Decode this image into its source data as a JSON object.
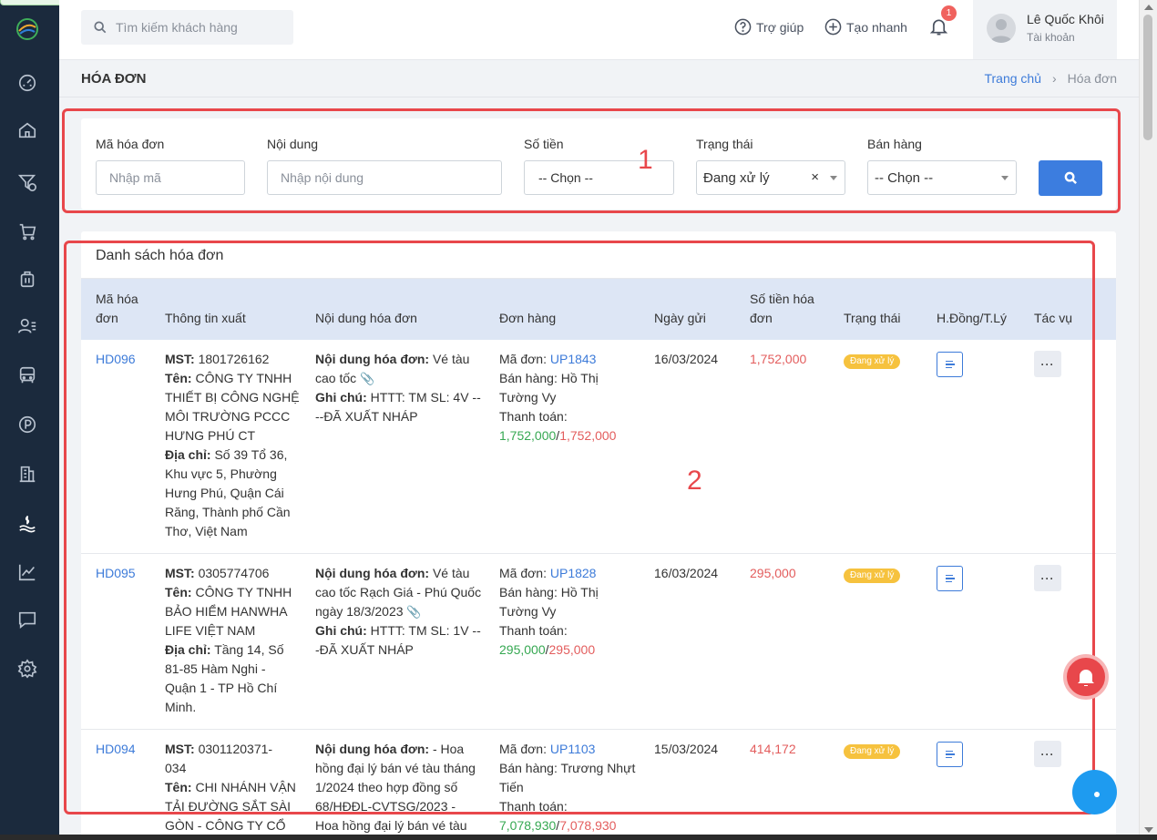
{
  "topbar": {
    "search_placeholder": "Tìm kiếm khách hàng",
    "help_label": "Trợ giúp",
    "quick_create_label": "Tạo nhanh",
    "notification_count": "1",
    "user_name": "Lê Quốc Khôi",
    "user_role": "Tài khoản"
  },
  "page": {
    "title": "HÓA ĐƠN",
    "breadcrumb_home": "Trang chủ",
    "breadcrumb_sep": "›",
    "breadcrumb_current": "Hóa đơn"
  },
  "filter": {
    "invoice_code_label": "Mã hóa đơn",
    "invoice_code_placeholder": "Nhập mã",
    "content_label": "Nội dung",
    "content_placeholder": "Nhập nội dung",
    "amount_label": "Số tiền",
    "amount_value": "-- Chọn --",
    "status_label": "Trạng thái",
    "status_value": "Đang xử lý",
    "status_clear": "×",
    "seller_label": "Bán hàng",
    "seller_value": "-- Chọn --"
  },
  "list": {
    "title": "Danh sách hóa đơn",
    "columns": {
      "code_1": "Mã hóa",
      "code_2": "đơn",
      "issue_info": "Thông tin xuất",
      "content": "Nội dung hóa đơn",
      "order": "Đơn hàng",
      "date": "Ngày gửi",
      "amount_1": "Số tiền hóa",
      "amount_2": "đơn",
      "status": "Trạng thái",
      "contract": "H.Đồng/T.Lý",
      "actions": "Tác vụ"
    },
    "labels": {
      "mst": "MST:",
      "name": "Tên:",
      "address": "Địa chỉ:",
      "content": "Nội dung hóa đơn:",
      "note": "Ghi chú:",
      "order_code": "Mã đơn:",
      "seller": "Bán hàng:",
      "payment": "Thanh toán:"
    },
    "rows": [
      {
        "code": "HD096",
        "mst": "1801726162",
        "name_lines": [
          "CÔNG TY TNHH",
          "THIẾT BỊ CÔNG NGHỆ",
          "MÔI TRƯỜNG PCCC",
          "HƯNG PHÚ CT"
        ],
        "address_lines": [
          "Số 39 Tổ 36,",
          "Khu vực 5, Phường",
          "Hưng Phú, Quận Cái",
          "Răng, Thành phố Cần",
          "Thơ, Việt Nam"
        ],
        "content_lines": [
          "Vé tàu",
          "cao tốc"
        ],
        "note_lines": [
          "HTTT: TM SL: 4V --",
          "--ĐÃ XUẤT NHÁP"
        ],
        "order_code": "UP1843",
        "seller_lines": [
          "Hồ Thị",
          "Tường Vy"
        ],
        "paid": "1,752,000",
        "total": "1,752,000",
        "date": "16/03/2024",
        "amount": "1,752,000",
        "status": "Đang xử lý"
      },
      {
        "code": "HD095",
        "mst": "0305774706",
        "name_lines": [
          "CÔNG TY TNHH",
          "BẢO HIỂM HANWHA",
          "LIFE VIỆT NAM"
        ],
        "address_lines": [
          "Tầng 14, Số",
          "81-85 Hàm Nghi -",
          "Quận 1 - TP Hồ Chí",
          "Minh."
        ],
        "content_lines": [
          "Vé tàu",
          "cao tốc Rạch Giá - Phú Quốc",
          "ngày 18/3/2023"
        ],
        "note_lines": [
          "HTTT: TM SL: 1V --",
          "-ĐÃ XUẤT NHÁP"
        ],
        "order_code": "UP1828",
        "seller_lines": [
          "Hồ Thị",
          "Tường Vy"
        ],
        "paid": "295,000",
        "total": "295,000",
        "date": "16/03/2024",
        "amount": "295,000",
        "status": "Đang xử lý"
      },
      {
        "code": "HD094",
        "mst_lines": [
          "0301120371-",
          "034"
        ],
        "name_lines": [
          "CHI NHÁNH VẬN",
          "TẢI ĐƯỜNG SẮT SÀI",
          "GÒN - CÔNG TY CỔ"
        ],
        "content_lines": [
          "- Hoa",
          "hồng đại lý bán vé tàu tháng",
          "1/2024 theo hợp đồng số",
          "68/HĐĐL-CVTSG/2023 -",
          "Hoa hồng đại lý bán vé tàu"
        ],
        "order_code": "UP1103",
        "seller_lines": [
          "Trương Nhựt",
          "Tiến"
        ],
        "paid": "7,078,930",
        "total": "7,078,930",
        "date": "15/03/2024",
        "amount": "414,172",
        "status": "Đang xử lý"
      }
    ]
  },
  "annotations": {
    "box1_label": "1",
    "box2_label": "2"
  },
  "colors": {
    "sidebar": "#1b2a3d",
    "primary": "#3c7ddf",
    "annotation": "#e8474b",
    "badge": "#f6c23e"
  }
}
